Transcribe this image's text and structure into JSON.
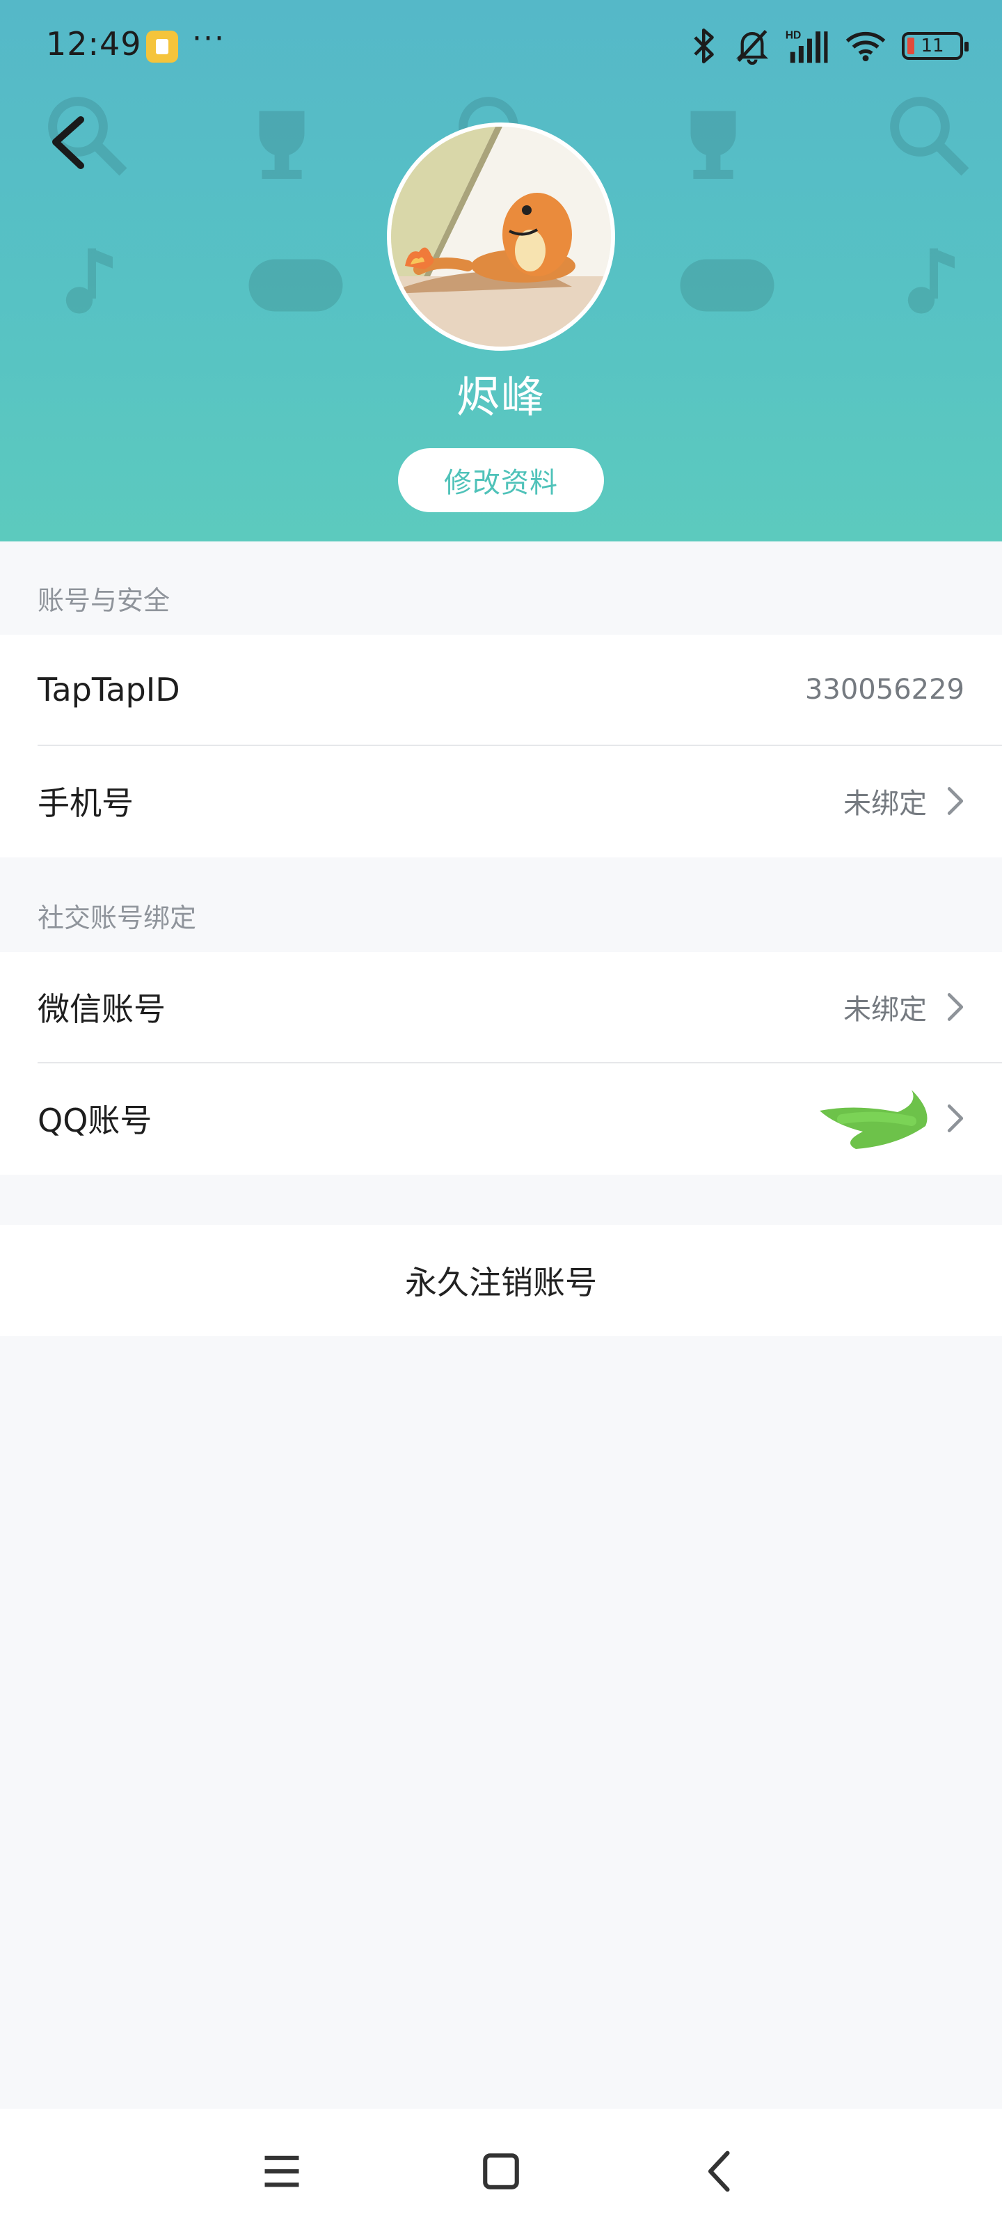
{
  "status_bar": {
    "time": "12:49",
    "more": "···",
    "battery_level": "11",
    "icons": [
      "bluetooth-icon",
      "muted-bell-icon",
      "hd-signal-icon",
      "wifi-icon",
      "battery-icon"
    ]
  },
  "header": {
    "username": "烬峰",
    "edit_profile_label": "修改资料",
    "colors": {
      "gradient_top": "#55b8c8",
      "gradient_bottom": "#5ccabe",
      "accent": "#4fc2b9"
    }
  },
  "account_security": {
    "title": "账号与安全",
    "rows": [
      {
        "label": "TapTapID",
        "value": "330056229"
      },
      {
        "label": "手机号",
        "value": "未绑定"
      }
    ]
  },
  "social_binding": {
    "title": "社交账号绑定",
    "rows": [
      {
        "label": "微信账号",
        "value": "未绑定"
      },
      {
        "label": "QQ账号",
        "value": ""
      }
    ]
  },
  "deactivate_label": "永久注销账号"
}
